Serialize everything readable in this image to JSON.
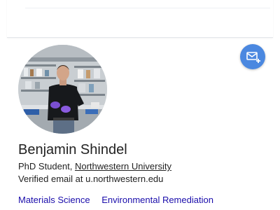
{
  "top_panel": {
    "cut_text": "·· ·  ·· · · ·  ·  · ·"
  },
  "profile": {
    "name": "Benjamin Shindel",
    "role_prefix": "PhD Student, ",
    "institution": "Northwestern University",
    "email_verified": "Verified email at u.northwestern.edu",
    "avatar_alt": "profile-photo",
    "interests": [
      "Materials Science",
      "Environmental Remediation"
    ]
  },
  "actions": {
    "follow_icon": "email-follow-icon"
  },
  "colors": {
    "follow_button": "#4b88e0",
    "interest_link": "#1a0dab",
    "text": "#222222"
  }
}
